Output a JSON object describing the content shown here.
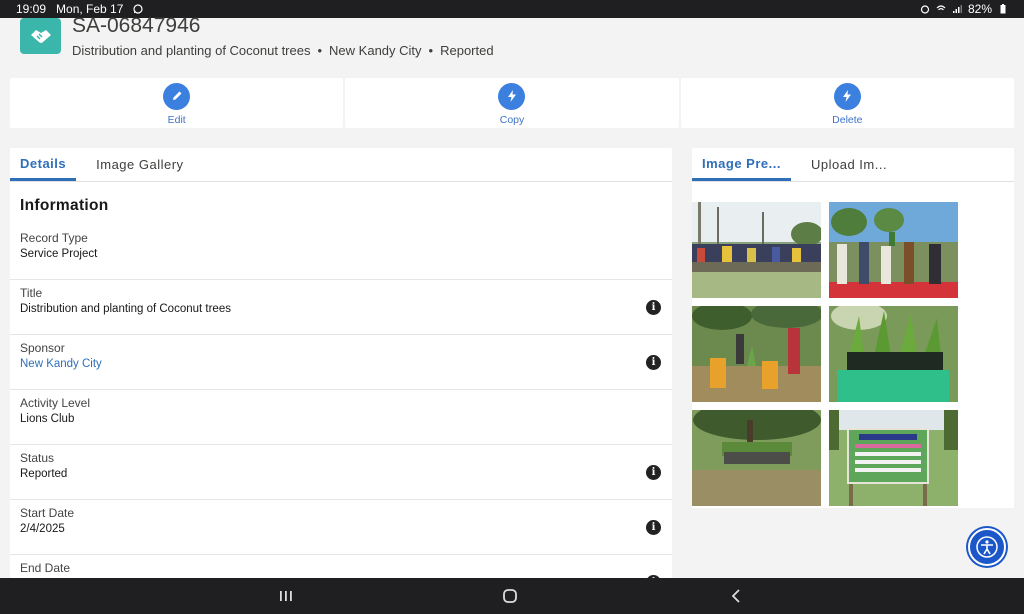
{
  "status_bar": {
    "time": "19:09",
    "date": "Mon, Feb 17",
    "battery": "82%"
  },
  "record": {
    "id": "SA-06847946",
    "subtitle_items": [
      "Distribution and planting of Coconut trees",
      "New Kandy City",
      "Reported"
    ],
    "separator": "•"
  },
  "actions": [
    {
      "label": "Edit",
      "icon": "pencil-icon"
    },
    {
      "label": "Copy",
      "icon": "lightning-icon"
    },
    {
      "label": "Delete",
      "icon": "lightning-icon"
    }
  ],
  "left_tabs": [
    "Details",
    "Image Gallery"
  ],
  "section_title": "Information",
  "fields": [
    {
      "label": "Record Type",
      "value": "Service Project",
      "link": false,
      "info": false
    },
    {
      "label": "Title",
      "value": "Distribution and planting of Coconut trees",
      "link": false,
      "info": true
    },
    {
      "label": "Sponsor",
      "value": "New Kandy City",
      "link": true,
      "info": true
    },
    {
      "label": "Activity Level",
      "value": "Lions Club",
      "link": false,
      "info": false
    },
    {
      "label": "Status",
      "value": "Reported",
      "link": false,
      "info": true
    },
    {
      "label": "Start Date",
      "value": "2/4/2025",
      "link": false,
      "info": true
    },
    {
      "label": "End Date",
      "value": "",
      "link": false,
      "info": true
    }
  ],
  "info_glyph": "i",
  "right_tabs": [
    "Image Pre...",
    "Upload Im..."
  ],
  "gallery_count": 6,
  "colors": {
    "accent": "#2f6fba",
    "action_circle": "#3b7fdf",
    "record_icon": "#3bb6aa"
  }
}
